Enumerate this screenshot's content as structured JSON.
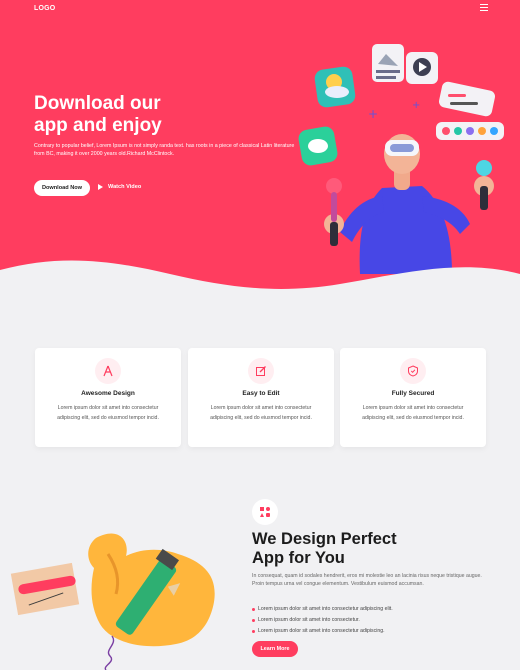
{
  "header": {
    "logo": "LOGO",
    "menu_icon": "hamburger-menu-icon"
  },
  "hero": {
    "title_line1": "Download our",
    "title_line2": "app and enjoy",
    "description": "Contrary to popular belief, Lorem Ipsum is not simply randa text. has roots in a piece of classical Latin literature from BC, making it over 2000 years old.Richard McClintock.",
    "download_label": "Download Now",
    "watch_label": "Watch Video",
    "accent_color": "#ff3d5f"
  },
  "features": [
    {
      "icon": "compass-design-icon",
      "title": "Awesome Design",
      "text": "Lorem ipsum dolor sit amet into consectetur adipiscing elit, sed do eiusmod tempor incid."
    },
    {
      "icon": "edit-icon",
      "title": "Easy to Edit",
      "text": "Lorem ipsum dolor sit amet into consectetur adipiscing elit, sed do eiusmod tempor incid."
    },
    {
      "icon": "shield-icon",
      "title": "Fully Secured",
      "text": "Lorem ipsum dolor sit amet into consectetur adipiscing elit, sed do eiusmod tempor incid."
    }
  ],
  "about": {
    "badge_icon": "design-tools-icon",
    "title_line1": "We Design Perfect",
    "title_line2": "App for You",
    "text": "In consequat, quam id sodales hendrerit, eros mi molestie leo an lacinia risus neque tristique augue. Proin tempus urna vel congue elementum. Vestibulum euismod accumsan.",
    "bullets": [
      "Lorem ipsum dolor sit amet into consectetur adipiscing elit.",
      "Lorem ipsum dolor sit amet into consectetur.",
      "Lorem ipsum dolor sit amet into consectetur adipiscing."
    ],
    "learn_label": "Learn More"
  }
}
